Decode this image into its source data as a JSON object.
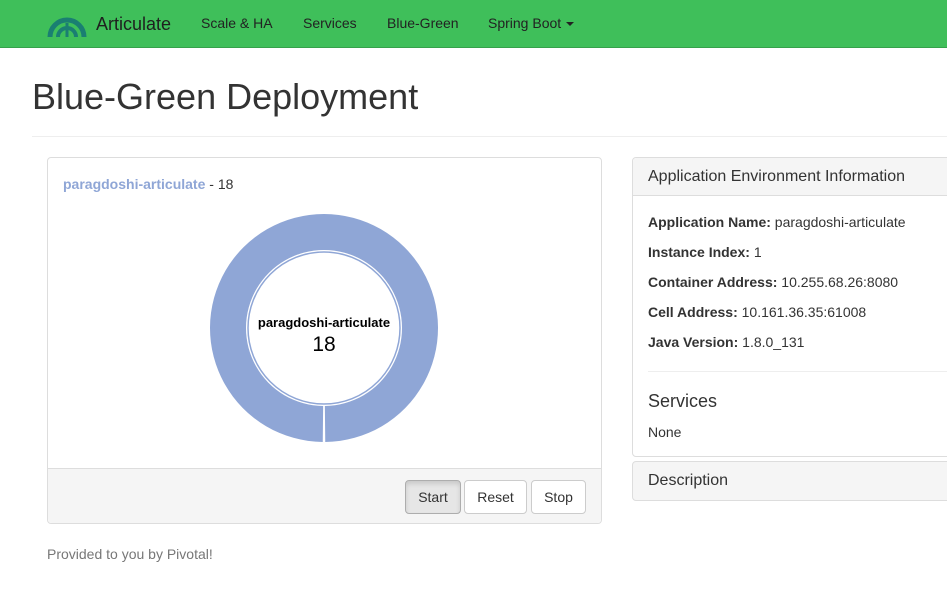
{
  "navbar": {
    "brand": "Articulate",
    "items": [
      "Scale & HA",
      "Services",
      "Blue-Green",
      "Spring Boot"
    ]
  },
  "page": {
    "title": "Blue-Green Deployment",
    "credit": "Provided to you by Pivotal!"
  },
  "chart_panel": {
    "app_name": "paragdoshi-articulate",
    "separator": " - ",
    "count": "18",
    "buttons": {
      "start": "Start",
      "reset": "Reset",
      "stop": "Stop"
    }
  },
  "chart_data": {
    "type": "pie",
    "categories": [
      "paragdoshi-articulate"
    ],
    "values": [
      18
    ],
    "center_label": "paragdoshi-articulate",
    "center_value": "18",
    "colors": [
      "#8fa6d6"
    ]
  },
  "env_panel": {
    "heading": "Application Environment Information",
    "fields": [
      {
        "label": "Application Name:",
        "value": "paragdoshi-articulate"
      },
      {
        "label": "Instance Index:",
        "value": "1"
      },
      {
        "label": "Container Address:",
        "value": "10.255.68.26:8080"
      },
      {
        "label": "Cell Address:",
        "value": "10.161.36.35:61008"
      },
      {
        "label": "Java Version:",
        "value": "1.8.0_131"
      }
    ],
    "services_title": "Services",
    "services_value": "None"
  },
  "description_panel": {
    "heading": "Description"
  },
  "colors": {
    "navbar": "#3fbf5a",
    "donut": "#8fa6d6",
    "link": "#8fa6d6"
  },
  "icons": {
    "brand": "pivotal-logo-icon",
    "dropdown": "caret-down-icon"
  }
}
